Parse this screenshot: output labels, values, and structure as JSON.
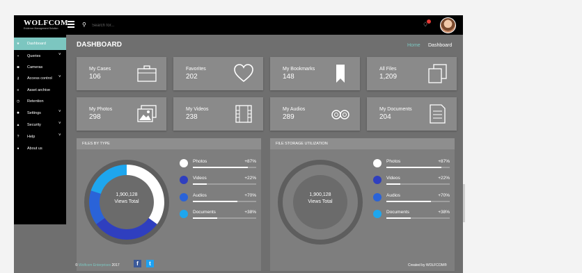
{
  "header": {
    "logo_text": "WOLFCOM.",
    "logo_sub": "Evidence Management Solution",
    "search_placeholder": "Search for...",
    "bell_icon": "bell-icon",
    "avatar_icon": "user-avatar"
  },
  "sidebar": {
    "items": [
      {
        "label": "Dashboard",
        "icon": "star-icon",
        "glyph": "★",
        "active": true,
        "chevron": false
      },
      {
        "label": "Queries",
        "icon": "file-icon",
        "glyph": "▪",
        "active": false,
        "chevron": true
      },
      {
        "label": "Cameras",
        "icon": "camera-icon",
        "glyph": "◙",
        "active": false,
        "chevron": false
      },
      {
        "label": "Access control",
        "icon": "key-icon",
        "glyph": "⚷",
        "active": false,
        "chevron": true
      },
      {
        "label": "Asset archive",
        "icon": "list-icon",
        "glyph": "≡",
        "active": false,
        "chevron": false
      },
      {
        "label": "Retention",
        "icon": "clock-icon",
        "glyph": "◷",
        "active": false,
        "chevron": false
      },
      {
        "label": "Settings",
        "icon": "gear-icon",
        "glyph": "✹",
        "active": false,
        "chevron": true
      },
      {
        "label": "Security",
        "icon": "lock-icon",
        "glyph": "▲",
        "active": false,
        "chevron": true
      },
      {
        "label": "Help",
        "icon": "question-icon",
        "glyph": "?",
        "active": false,
        "chevron": true
      },
      {
        "label": "About us",
        "icon": "info-icon",
        "glyph": "●",
        "active": false,
        "chevron": false
      }
    ]
  },
  "page": {
    "title": "DASHBOARD",
    "breadcrumb_home": "Home",
    "breadcrumb_current": "Dashboard"
  },
  "cards": [
    {
      "title": "My Cases",
      "value": "106",
      "icon": "briefcase-icon"
    },
    {
      "title": "Favorites",
      "value": "202",
      "icon": "heart-icon"
    },
    {
      "title": "My Bookmarks",
      "value": "148",
      "icon": "bookmark-icon"
    },
    {
      "title": "All Files",
      "value": "1,209",
      "icon": "files-icon"
    },
    {
      "title": "My Photos",
      "value": "298",
      "icon": "photos-icon"
    },
    {
      "title": "My Videos",
      "value": "238",
      "icon": "film-icon"
    },
    {
      "title": "My Audios",
      "value": "289",
      "icon": "tape-icon"
    },
    {
      "title": "My Documents",
      "value": "204",
      "icon": "document-icon"
    }
  ],
  "panels": {
    "files_by_type": {
      "title": "FILES BY TYPE",
      "center_value": "1,900,128",
      "center_label": "Views Total"
    },
    "file_storage": {
      "title": "FILE STORAGE UTILIZATION",
      "center_value": "1,900,128",
      "center_label": "Views Total"
    }
  },
  "chart_data": [
    {
      "type": "pie",
      "title": "FILES BY TYPE",
      "categories": [
        "Photos",
        "Videos",
        "Audios",
        "Documents"
      ],
      "values": [
        35,
        30,
        15,
        20
      ],
      "colors": [
        "#ffffff",
        "#2f3fbf",
        "#2a63d8",
        "#1ea6ee"
      ]
    }
  ],
  "legend": [
    {
      "name": "Photos",
      "pct": "+87%",
      "progress": 0.87,
      "color": "#ffffff"
    },
    {
      "name": "Videos",
      "pct": "+22%",
      "progress": 0.22,
      "color": "#2f3fbf"
    },
    {
      "name": "Audios",
      "pct": "+70%",
      "progress": 0.7,
      "color": "#2a63d8"
    },
    {
      "name": "Documents",
      "pct": "+38%",
      "progress": 0.38,
      "color": "#1ea6ee"
    }
  ],
  "footer": {
    "copy_symbol": "©",
    "brand": "Wolfcom Enterprises",
    "year": "2017",
    "facebook": "f",
    "twitter": "t",
    "created_by": "Created by WOLFCOM®"
  },
  "colors": {
    "accent": "#7cc6c0",
    "background": "#6f6f6f",
    "card": "#8a8a8a"
  }
}
